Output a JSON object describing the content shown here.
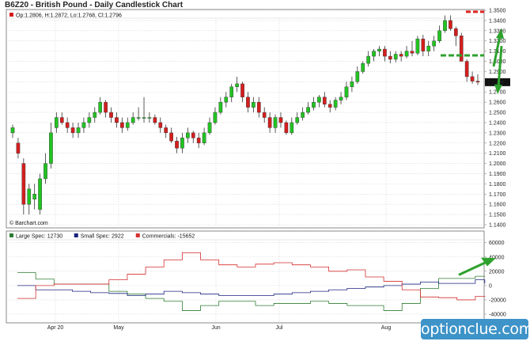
{
  "chart_data": [
    {
      "type": "candlestick",
      "title": "B6Z20 - British Pound - Daily Candlestick Chart",
      "ohlc_label": "Op:1.2806, H:1.2872, Lo:1.2768, Cl:1.2796",
      "last_price": "1.2796",
      "watermark": "© Barchart.com",
      "y_ticks": [
        "1.3500",
        "1.3400",
        "1.3300",
        "1.3200",
        "1.3100",
        "1.3000",
        "1.2900",
        "1.2800",
        "1.2700",
        "1.2600",
        "1.2500",
        "1.2400",
        "1.2300",
        "1.2200",
        "1.2100",
        "1.2000",
        "1.1900",
        "1.1800",
        "1.1700",
        "1.1600",
        "1.1500",
        "1.1400"
      ],
      "ylim": [
        1.14,
        1.35
      ],
      "x_labels": [
        "Apr 20",
        "May",
        "Jun",
        "Jul",
        "Aug"
      ],
      "candles": [
        [
          1.23,
          1.238,
          1.225,
          1.235
        ],
        [
          1.22,
          1.225,
          1.205,
          1.21
        ],
        [
          1.2,
          1.205,
          1.15,
          1.16
        ],
        [
          1.16,
          1.18,
          1.15,
          1.175
        ],
        [
          1.165,
          1.18,
          1.155,
          1.17
        ],
        [
          1.155,
          1.19,
          1.15,
          1.185
        ],
        [
          1.185,
          1.21,
          1.18,
          1.2
        ],
        [
          1.2,
          1.24,
          1.195,
          1.23
        ],
        [
          1.235,
          1.25,
          1.23,
          1.245
        ],
        [
          1.245,
          1.25,
          1.238,
          1.24
        ],
        [
          1.24,
          1.245,
          1.23,
          1.235
        ],
        [
          1.235,
          1.24,
          1.225,
          1.23
        ],
        [
          1.23,
          1.24,
          1.225,
          1.235
        ],
        [
          1.235,
          1.245,
          1.23,
          1.24
        ],
        [
          1.24,
          1.25,
          1.235,
          1.245
        ],
        [
          1.245,
          1.255,
          1.24,
          1.25
        ],
        [
          1.25,
          1.265,
          1.248,
          1.26
        ],
        [
          1.26,
          1.262,
          1.245,
          1.25
        ],
        [
          1.25,
          1.255,
          1.24,
          1.245
        ],
        [
          1.245,
          1.25,
          1.235,
          1.24
        ],
        [
          1.24,
          1.245,
          1.23,
          1.235
        ],
        [
          1.235,
          1.245,
          1.232,
          1.24
        ],
        [
          1.24,
          1.25,
          1.238,
          1.245
        ],
        [
          1.245,
          1.255,
          1.242,
          1.245
        ],
        [
          1.245,
          1.265,
          1.24,
          1.245
        ],
        [
          1.245,
          1.25,
          1.24,
          1.245
        ],
        [
          1.245,
          1.248,
          1.238,
          1.24
        ],
        [
          1.24,
          1.245,
          1.23,
          1.235
        ],
        [
          1.235,
          1.238,
          1.225,
          1.23
        ],
        [
          1.23,
          1.235,
          1.22,
          1.222
        ],
        [
          1.222,
          1.226,
          1.21,
          1.215
        ],
        [
          1.215,
          1.23,
          1.21,
          1.225
        ],
        [
          1.225,
          1.235,
          1.22,
          1.23
        ],
        [
          1.23,
          1.232,
          1.22,
          1.225
        ],
        [
          1.225,
          1.23,
          1.215,
          1.22
        ],
        [
          1.22,
          1.235,
          1.218,
          1.23
        ],
        [
          1.23,
          1.245,
          1.228,
          1.24
        ],
        [
          1.24,
          1.255,
          1.238,
          1.25
        ],
        [
          1.25,
          1.265,
          1.248,
          1.26
        ],
        [
          1.26,
          1.27,
          1.255,
          1.265
        ],
        [
          1.265,
          1.278,
          1.26,
          1.275
        ],
        [
          1.275,
          1.285,
          1.27,
          1.278
        ],
        [
          1.278,
          1.28,
          1.26,
          1.265
        ],
        [
          1.265,
          1.27,
          1.25,
          1.255
        ],
        [
          1.255,
          1.265,
          1.25,
          1.26
        ],
        [
          1.26,
          1.265,
          1.245,
          1.25
        ],
        [
          1.25,
          1.255,
          1.24,
          1.245
        ],
        [
          1.245,
          1.25,
          1.23,
          1.235
        ],
        [
          1.235,
          1.248,
          1.23,
          1.245
        ],
        [
          1.245,
          1.25,
          1.235,
          1.24
        ],
        [
          1.24,
          1.242,
          1.228,
          1.23
        ],
        [
          1.23,
          1.245,
          1.228,
          1.24
        ],
        [
          1.24,
          1.25,
          1.238,
          1.245
        ],
        [
          1.245,
          1.255,
          1.242,
          1.25
        ],
        [
          1.25,
          1.26,
          1.248,
          1.255
        ],
        [
          1.255,
          1.265,
          1.252,
          1.26
        ],
        [
          1.26,
          1.267,
          1.255,
          1.265
        ],
        [
          1.265,
          1.27,
          1.255,
          1.258
        ],
        [
          1.258,
          1.262,
          1.25,
          1.255
        ],
        [
          1.255,
          1.265,
          1.252,
          1.262
        ],
        [
          1.262,
          1.27,
          1.258,
          1.265
        ],
        [
          1.265,
          1.28,
          1.262,
          1.275
        ],
        [
          1.275,
          1.285,
          1.27,
          1.28
        ],
        [
          1.28,
          1.295,
          1.278,
          1.29
        ],
        [
          1.29,
          1.3,
          1.288,
          1.298
        ],
        [
          1.298,
          1.31,
          1.295,
          1.305
        ],
        [
          1.305,
          1.312,
          1.3,
          1.31
        ],
        [
          1.31,
          1.315,
          1.305,
          1.312
        ],
        [
          1.312,
          1.315,
          1.3,
          1.305
        ],
        [
          1.305,
          1.31,
          1.298,
          1.302
        ],
        [
          1.302,
          1.31,
          1.299,
          1.307
        ],
        [
          1.307,
          1.31,
          1.3,
          1.305
        ],
        [
          1.305,
          1.315,
          1.303,
          1.31
        ],
        [
          1.31,
          1.32,
          1.305,
          1.308
        ],
        [
          1.308,
          1.325,
          1.306,
          1.322
        ],
        [
          1.322,
          1.326,
          1.305,
          1.31
        ],
        [
          1.31,
          1.32,
          1.305,
          1.315
        ],
        [
          1.315,
          1.325,
          1.31,
          1.32
        ],
        [
          1.32,
          1.335,
          1.318,
          1.33
        ],
        [
          1.33,
          1.345,
          1.328,
          1.34
        ],
        [
          1.34,
          1.345,
          1.33,
          1.332
        ],
        [
          1.332,
          1.334,
          1.315,
          1.325
        ],
        [
          1.325,
          1.328,
          1.3,
          1.3
        ],
        [
          1.3,
          1.302,
          1.28,
          1.285
        ],
        [
          1.285,
          1.29,
          1.278,
          1.2806
        ],
        [
          1.2806,
          1.2872,
          1.2768,
          1.2796
        ]
      ]
    },
    {
      "type": "line",
      "title": "",
      "y_ticks": [
        "60000",
        "40000",
        "20000",
        "0",
        "-20000",
        "-40000"
      ],
      "ylim": [
        -50000,
        63000
      ],
      "series": [
        {
          "name": "Large Spec: 12730",
          "color": "#2e7d32",
          "values": [
            18000,
            9000,
            2000,
            2000,
            2000,
            -8000,
            -12000,
            -18000,
            -22000,
            -35000,
            -28000,
            -22000,
            -22000,
            -28000,
            -25000,
            -25000,
            -22000,
            -25000,
            -28000,
            -28000,
            -35000,
            -25000,
            -4000,
            10000,
            10000,
            13000,
            12730
          ]
        },
        {
          "name": "Small Spec: 2922",
          "color": "#1a237e",
          "values": [
            0,
            -6000,
            -6000,
            -8000,
            -10000,
            -11000,
            -14000,
            -12000,
            -8000,
            -10000,
            -12000,
            -14000,
            -14000,
            -14000,
            -12000,
            -10000,
            -8000,
            -6000,
            -4000,
            -2000,
            0,
            2000,
            5000,
            3000,
            3000,
            8000,
            2922
          ]
        },
        {
          "name": "Commercials: -15652",
          "color": "#d32f2f",
          "values": [
            -18000,
            0,
            2000,
            2000,
            2000,
            8000,
            16000,
            26000,
            36000,
            46000,
            36000,
            29000,
            26000,
            30000,
            32000,
            29000,
            26000,
            20000,
            22000,
            12000,
            6000,
            -6000,
            -16000,
            -17000,
            -20000,
            -15000,
            -15652
          ]
        }
      ]
    }
  ],
  "watermark_logo": "optionclue.com",
  "colors": {
    "up": "#22c322",
    "down": "#d41e1e",
    "annotation": "#2ea22e",
    "resistance": "#e02424"
  }
}
